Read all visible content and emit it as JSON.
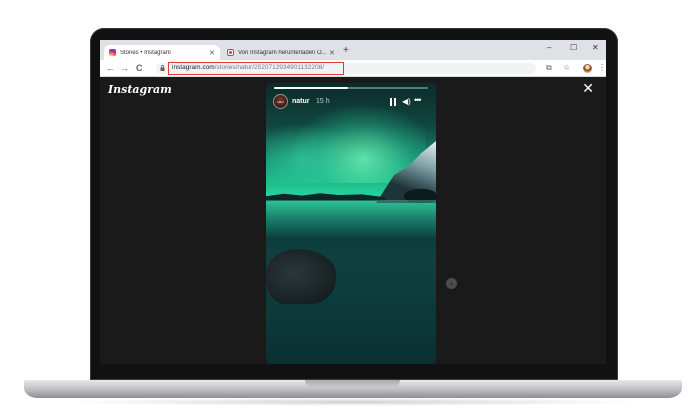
{
  "browser": {
    "tabs": [
      {
        "label": "Stories • Instagram",
        "active": true,
        "icon": "instagram-icon"
      },
      {
        "label": "Von Instagram herunterladen O...",
        "active": false,
        "icon": "page-icon"
      }
    ],
    "new_tab_label": "+",
    "window_controls": {
      "minimize": "–",
      "maximize": "☐",
      "close": "✕"
    },
    "nav": {
      "back": "←",
      "forward": "→",
      "reload": "C"
    },
    "url_host": "instagram.com",
    "url_path": "/stories/natur/2520712934901132208/",
    "toolbar_icons": {
      "translate": "⧉",
      "bookmark": "☆",
      "menu": "⋮"
    }
  },
  "instagram": {
    "logo": "Instagram",
    "close": "✕",
    "story": {
      "progress": 0.48,
      "avatar_text": "natur",
      "username": "natur",
      "time_ago": "15 h",
      "volume": "◀)",
      "more": "•••"
    },
    "next": "›"
  },
  "colors": {
    "highlight_box": "#e53935",
    "viewer_bg": "#1a1a1a",
    "aurora": "#27d49a"
  }
}
